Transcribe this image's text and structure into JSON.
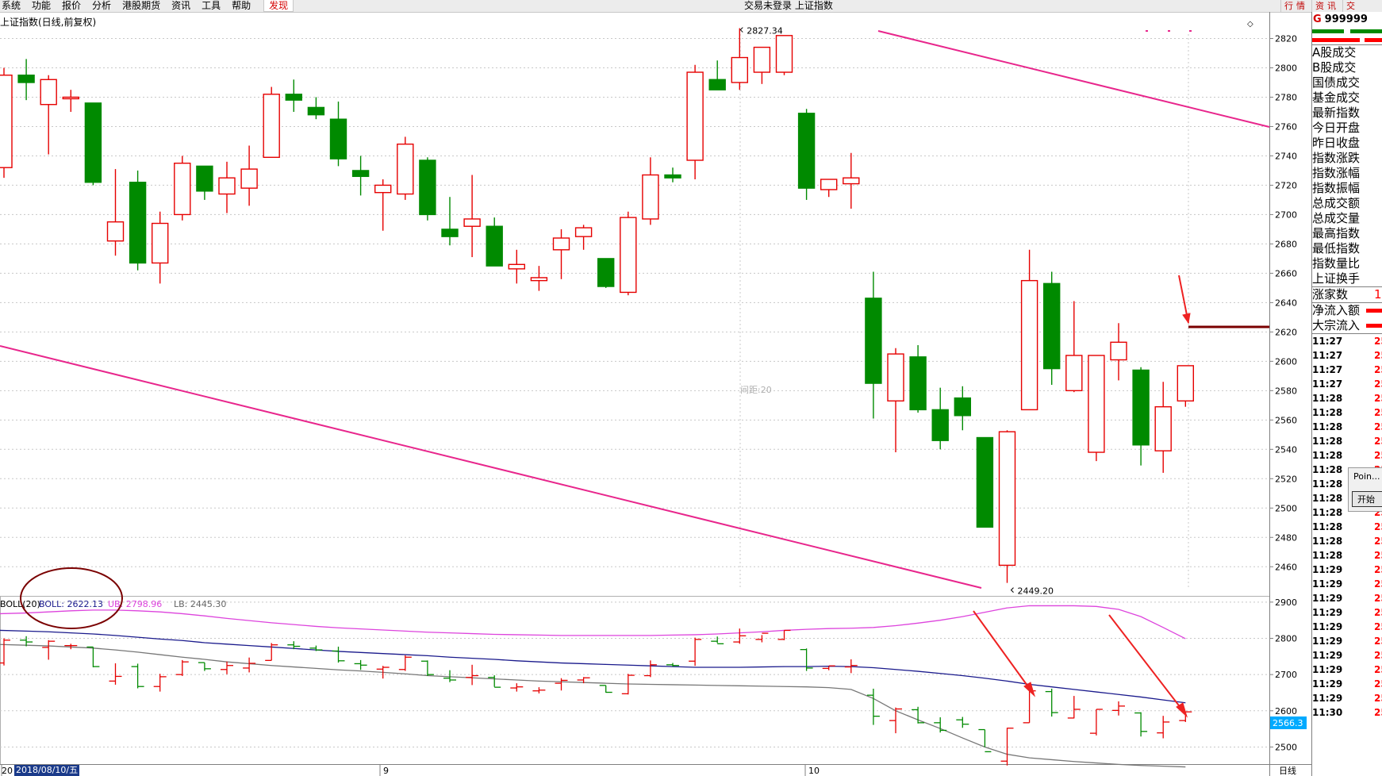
{
  "menubar": {
    "items": [
      "系统",
      "功能",
      "报价",
      "分析",
      "港股期货",
      "资讯",
      "工具",
      "帮助",
      "发现"
    ],
    "status": "交易未登录   上证指数",
    "right_tabs": [
      "行情",
      "资讯",
      "交"
    ]
  },
  "chart_title": "上证指数(日线,前复权)",
  "interval_label": "间距:20",
  "period_label": "日线",
  "boll_legend": {
    "name": "BOLL(20)",
    "boll": "BOLL: 2622.13",
    "ub": "UB: 2798.96",
    "lb": "LB: 2445.30"
  },
  "x_axis": {
    "date_box": "2018/08/10/五",
    "month_ticks": [
      "20",
      "9",
      "10"
    ]
  },
  "current_value_box": "2566.3",
  "chart_data": {
    "type": "candlestick",
    "main_y_range": [
      2445,
      2830
    ],
    "main_y_ticks": [
      2460,
      2480,
      2500,
      2520,
      2540,
      2560,
      2580,
      2600,
      2620,
      2640,
      2660,
      2680,
      2700,
      2720,
      2740,
      2760,
      2780,
      2800,
      2820
    ],
    "boll_y_range": [
      2455,
      2915
    ],
    "boll_y_ticks": [
      2500,
      2600,
      2700,
      2800,
      2900
    ],
    "annotations": {
      "high": "2827.34",
      "low": "2449.20"
    },
    "candles": [
      [
        2732,
        2800,
        2725,
        2795
      ],
      [
        2795,
        2806,
        2778,
        2790
      ],
      [
        2775,
        2795,
        2741,
        2792
      ],
      [
        2780,
        2785,
        2770,
        2780
      ],
      [
        2776,
        2776,
        2720,
        2722
      ],
      [
        2682,
        2731,
        2672,
        2695
      ],
      [
        2722,
        2730,
        2662,
        2667
      ],
      [
        2667,
        2702,
        2653,
        2694
      ],
      [
        2700,
        2740,
        2696,
        2735
      ],
      [
        2733,
        2733,
        2710,
        2716
      ],
      [
        2714,
        2736,
        2701,
        2725
      ],
      [
        2718,
        2747,
        2706,
        2731
      ],
      [
        2739,
        2787,
        2739,
        2782
      ],
      [
        2782,
        2792,
        2770,
        2778
      ],
      [
        2773,
        2780,
        2765,
        2768
      ],
      [
        2765,
        2777,
        2733,
        2738
      ],
      [
        2730,
        2740,
        2713,
        2726
      ],
      [
        2715,
        2724,
        2689,
        2720
      ],
      [
        2714,
        2753,
        2710,
        2748
      ],
      [
        2737,
        2739,
        2696,
        2700
      ],
      [
        2690,
        2712,
        2679,
        2685
      ],
      [
        2692,
        2727,
        2671,
        2697
      ],
      [
        2692,
        2698,
        2666,
        2665
      ],
      [
        2663,
        2676,
        2653,
        2666
      ],
      [
        2655,
        2665,
        2648,
        2657
      ],
      [
        2676,
        2690,
        2656,
        2684
      ],
      [
        2685,
        2693,
        2676,
        2691
      ],
      [
        2670,
        2670,
        2650,
        2651
      ],
      [
        2647,
        2702,
        2645,
        2698
      ],
      [
        2697,
        2739,
        2693,
        2727
      ],
      [
        2727,
        2732,
        2722,
        2725
      ],
      [
        2737,
        2802,
        2724,
        2797
      ],
      [
        2792,
        2805,
        2787,
        2785
      ],
      [
        2790,
        2827,
        2785,
        2807
      ],
      [
        2797,
        2809,
        2789,
        2814
      ],
      [
        2797,
        2822,
        2795,
        2822
      ],
      [
        2769,
        2772,
        2710,
        2718
      ],
      [
        2717,
        2722,
        2712,
        2724
      ],
      [
        2721,
        2742,
        2704,
        2725
      ],
      [
        2643,
        2661,
        2561,
        2585
      ],
      [
        2573,
        2609,
        2538,
        2605
      ],
      [
        2603,
        2611,
        2565,
        2567
      ],
      [
        2567,
        2582,
        2540,
        2546
      ],
      [
        2575,
        2583,
        2553,
        2563
      ],
      [
        2548,
        2548,
        2500,
        2487
      ],
      [
        2461,
        2553,
        2449,
        2552
      ],
      [
        2567,
        2676,
        2567,
        2655
      ],
      [
        2653,
        2661,
        2584,
        2595
      ],
      [
        2580,
        2641,
        2579,
        2604
      ],
      [
        2538,
        2604,
        2532,
        2604
      ],
      [
        2601,
        2626,
        2587,
        2613
      ],
      [
        2594,
        2596,
        2529,
        2543
      ],
      [
        2539,
        2586,
        2524,
        2569
      ],
      [
        2573,
        2597,
        2569,
        2597
      ]
    ],
    "boll_mid": [
      2822,
      2820,
      2818,
      2815,
      2812,
      2808,
      2803,
      2798,
      2794,
      2788,
      2784,
      2780,
      2776,
      2772,
      2768,
      2764,
      2761,
      2758,
      2755,
      2752,
      2748,
      2745,
      2742,
      2738,
      2735,
      2732,
      2730,
      2728,
      2726,
      2724,
      2722,
      2720,
      2720,
      2720,
      2721,
      2722,
      2722,
      2723,
      2722,
      2719,
      2714,
      2709,
      2703,
      2697,
      2690,
      2682,
      2673,
      2666,
      2659,
      2652,
      2645,
      2638,
      2630,
      2622
    ],
    "boll_ub": [
      2868,
      2870,
      2873,
      2876,
      2878,
      2878,
      2876,
      2873,
      2868,
      2862,
      2855,
      2849,
      2843,
      2838,
      2833,
      2829,
      2826,
      2823,
      2820,
      2817,
      2815,
      2813,
      2811,
      2810,
      2809,
      2808,
      2808,
      2808,
      2808,
      2808,
      2809,
      2810,
      2812,
      2815,
      2818,
      2822,
      2825,
      2827,
      2828,
      2830,
      2835,
      2842,
      2850,
      2860,
      2872,
      2884,
      2890,
      2890,
      2890,
      2888,
      2880,
      2860,
      2830,
      2799
    ],
    "boll_lb": [
      2783,
      2781,
      2779,
      2776,
      2773,
      2768,
      2762,
      2755,
      2748,
      2742,
      2735,
      2730,
      2725,
      2721,
      2717,
      2713,
      2710,
      2706,
      2702,
      2697,
      2694,
      2691,
      2688,
      2685,
      2682,
      2680,
      2678,
      2676,
      2674,
      2673,
      2672,
      2671,
      2670,
      2669,
      2668,
      2667,
      2666,
      2664,
      2659,
      2634,
      2600,
      2575,
      2551,
      2525,
      2500,
      2480,
      2470,
      2465,
      2460,
      2456,
      2452,
      2449,
      2447,
      2445
    ]
  },
  "right_panel": {
    "code": "999999",
    "labels": [
      "A股成交",
      "B股成交",
      "国债成交",
      "基金成交",
      "最新指数",
      "今日开盘",
      "昨日收盘",
      "指数涨跌",
      "指数涨幅",
      "指数振幅",
      "总成交额",
      "总成交量",
      "最高指数",
      "最低指数",
      "指数量比",
      "上证换手"
    ],
    "up_count_label": "涨家数",
    "up_count_value": "1",
    "flow_labels": [
      "净流入额",
      "大宗流入"
    ],
    "times": [
      "11:27",
      "11:27",
      "11:27",
      "11:27",
      "11:28",
      "11:28",
      "11:28",
      "11:28",
      "11:28",
      "11:28",
      "11:28",
      "11:28",
      "11:28",
      "11:28",
      "11:28",
      "11:28",
      "11:29",
      "11:29",
      "11:29",
      "11:29",
      "11:29",
      "11:29",
      "11:29",
      "11:29",
      "11:29",
      "11:29",
      "11:30"
    ],
    "tick_value": "25"
  },
  "popup": {
    "title": "Poin...",
    "button": "开始"
  },
  "colors": {
    "up": "#e60000",
    "down": "#008a00",
    "trendline": "#e8268c",
    "boll_mid": "#1a1a8c",
    "boll_ub": "#dd44dd",
    "boll_lb": "#777777",
    "circle": "#7a0000",
    "arrow": "#ee2222",
    "level_line": "#7a0000"
  }
}
